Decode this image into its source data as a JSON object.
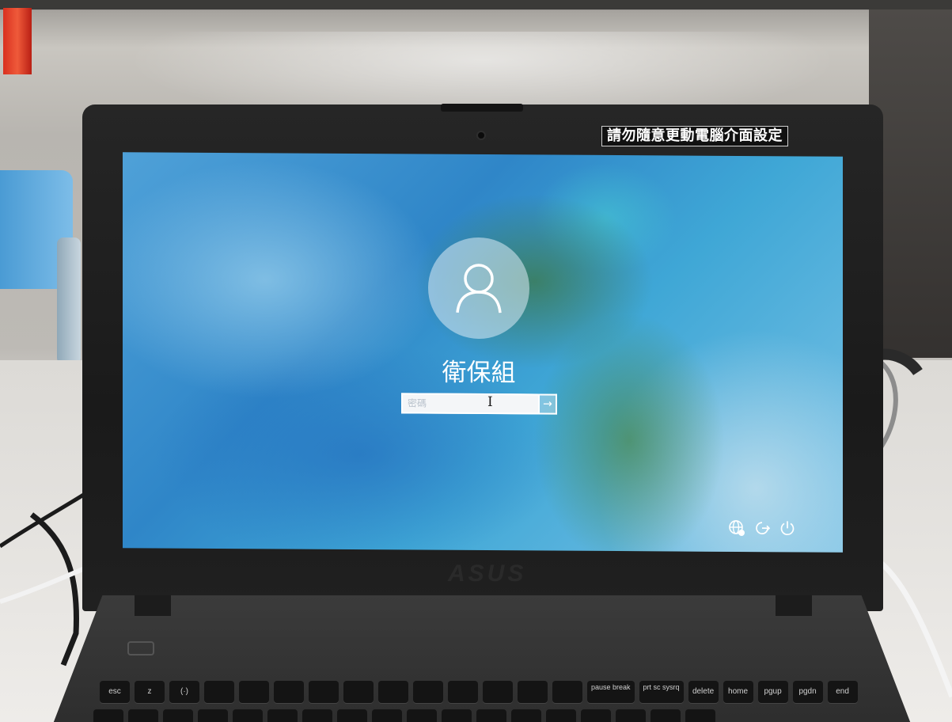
{
  "sticker": {
    "text": "請勿隨意更動電腦介面設定"
  },
  "lock_screen": {
    "username": "衛保組",
    "password_placeholder": "密碼",
    "cursor_glyph": "I",
    "submit_glyph": "→"
  },
  "brand": {
    "logo_text": "ASUS"
  },
  "keyboard": {
    "function_row": [
      "esc",
      "z",
      "(·)",
      "",
      "",
      "",
      "",
      "",
      "",
      "",
      "",
      "",
      "",
      "",
      "pause break",
      "prt sc sysrq",
      "delete",
      "home",
      "pgup",
      "pgdn",
      "end"
    ]
  },
  "icons": [
    "user-avatar-icon",
    "accessibility-icon",
    "ease-of-access-icon",
    "power-icon",
    "arrow-right-icon"
  ],
  "colors": {
    "screen_accent": "#2f86c8",
    "text": "#ffffff",
    "bezel": "#1a1a1a"
  }
}
